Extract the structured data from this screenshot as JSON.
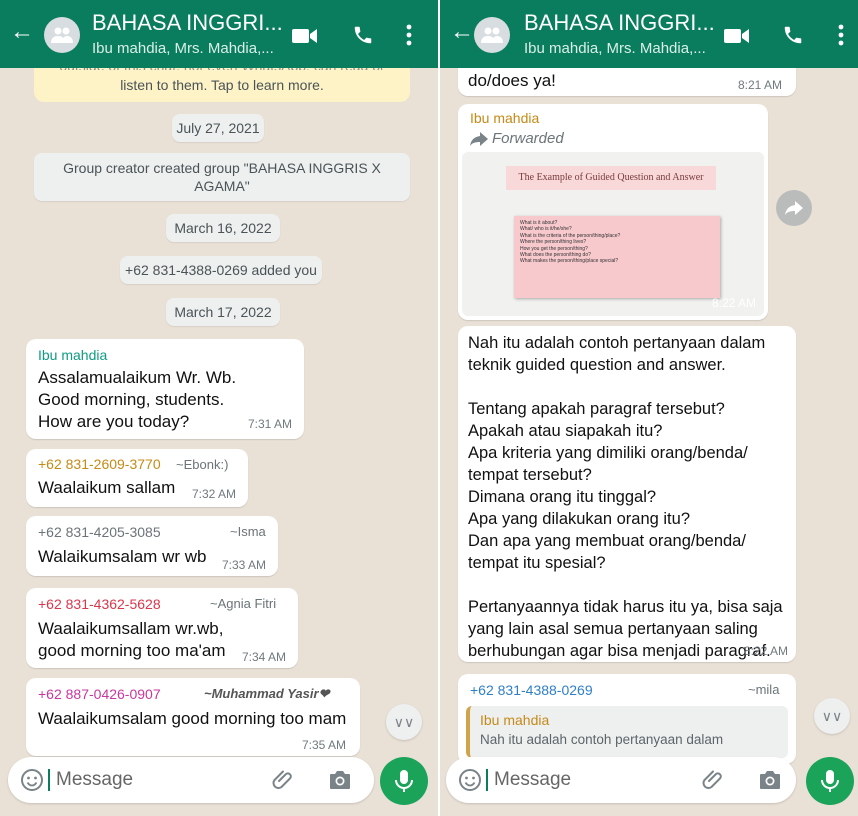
{
  "header": {
    "title": "BAHASA INGGRI...",
    "subtitle": "Ibu mahdia, Mrs. Mahdia,..."
  },
  "colors": {
    "header": "#0b7d5f",
    "chat_bg": "#e9e1d6",
    "accent": "#1ba35a",
    "sender_ibu": "#0f9b83",
    "sender_ebonk": "#c58a18",
    "sender_isma": "#6b7478",
    "sender_agnia": "#d9374a",
    "sender_yasir": "#c8379f",
    "sender_mila": "#2f7fc6",
    "quote_bar": "#cfa44a"
  },
  "left": {
    "encryption_notice_line": "listen to them. Tap to learn more.",
    "system_messages": [
      "July 27, 2021",
      "Group creator created group \"BAHASA INGGRIS X AGAMA\"",
      "March 16, 2022",
      "+62 831-4388-0269 added you",
      "March 17, 2022"
    ],
    "messages": [
      {
        "sender": "Ibu mahdia",
        "alias": "",
        "text": "Assalamualaikum Wr. Wb.\nGood morning, students.\nHow are you today?",
        "time": "7:31 AM"
      },
      {
        "sender": "+62 831-2609-3770",
        "alias": "~Ebonk:)",
        "text": "Waalaikum sallam",
        "time": "7:32 AM"
      },
      {
        "sender": "+62 831-4205-3085",
        "alias": "~Isma",
        "text": "Walaikumsalam wr wb",
        "time": "7:33 AM"
      },
      {
        "sender": "+62 831-4362-5628",
        "alias": "~Agnia Fitri",
        "text": "Waalaikumsallam wr.wb,\ngood morning too ma'am",
        "time": "7:34 AM"
      },
      {
        "sender": "+62 887-0426-0907",
        "alias": "~Muhammad Yasir❤",
        "text": "Waalaikumsalam good morning too mam",
        "time": "7:35 AM"
      }
    ]
  },
  "right": {
    "top_message": {
      "text": "do/does ya!",
      "time": "8:21 AM"
    },
    "forwarded": {
      "sender": "Ibu mahdia",
      "label": "Forwarded",
      "image_title": "The Example of Guided Question and Answer",
      "image_lines": [
        "What is it about?",
        "What/ who is it/he/she?",
        "What is the criteria of the person/thing/place?",
        "Where the person/thing lives?",
        "How you get the person/thing?",
        "What does the person/thing do?",
        "What makes the person/thing/place special?"
      ],
      "time": "8:22 AM"
    },
    "long_message": {
      "text": "Nah itu adalah contoh pertanyaan dalam\nteknik guided question and answer.\n\nTentang apakah paragraf tersebut?\nApakah atau siapakah itu?\nApa kriteria yang dimiliki orang/benda/\ntempat tersebut?\nDimana orang itu tinggal?\nApa yang dilakukan orang itu?\nDan apa yang membuat orang/benda/\ntempat itu spesial?\n\nPertanyaannya tidak harus itu ya, bisa saja\nyang lain asal semua pertanyaan saling\nberhubungan agar bisa menjadi paragraf.",
      "time": "8:22 AM"
    },
    "reply": {
      "sender": "+62 831-4388-0269",
      "alias": "~mila",
      "quoted_sender": "Ibu mahdia",
      "quoted_text": "Nah itu adalah contoh pertanyaan dalam"
    }
  },
  "composer": {
    "placeholder": "Message"
  },
  "icons": [
    "back-arrow-icon",
    "group-avatar-icon",
    "video-call-icon",
    "phone-icon",
    "more-vert-icon",
    "emoji-icon",
    "attach-icon",
    "camera-icon",
    "mic-icon",
    "scroll-down-icon",
    "forward-icon"
  ]
}
